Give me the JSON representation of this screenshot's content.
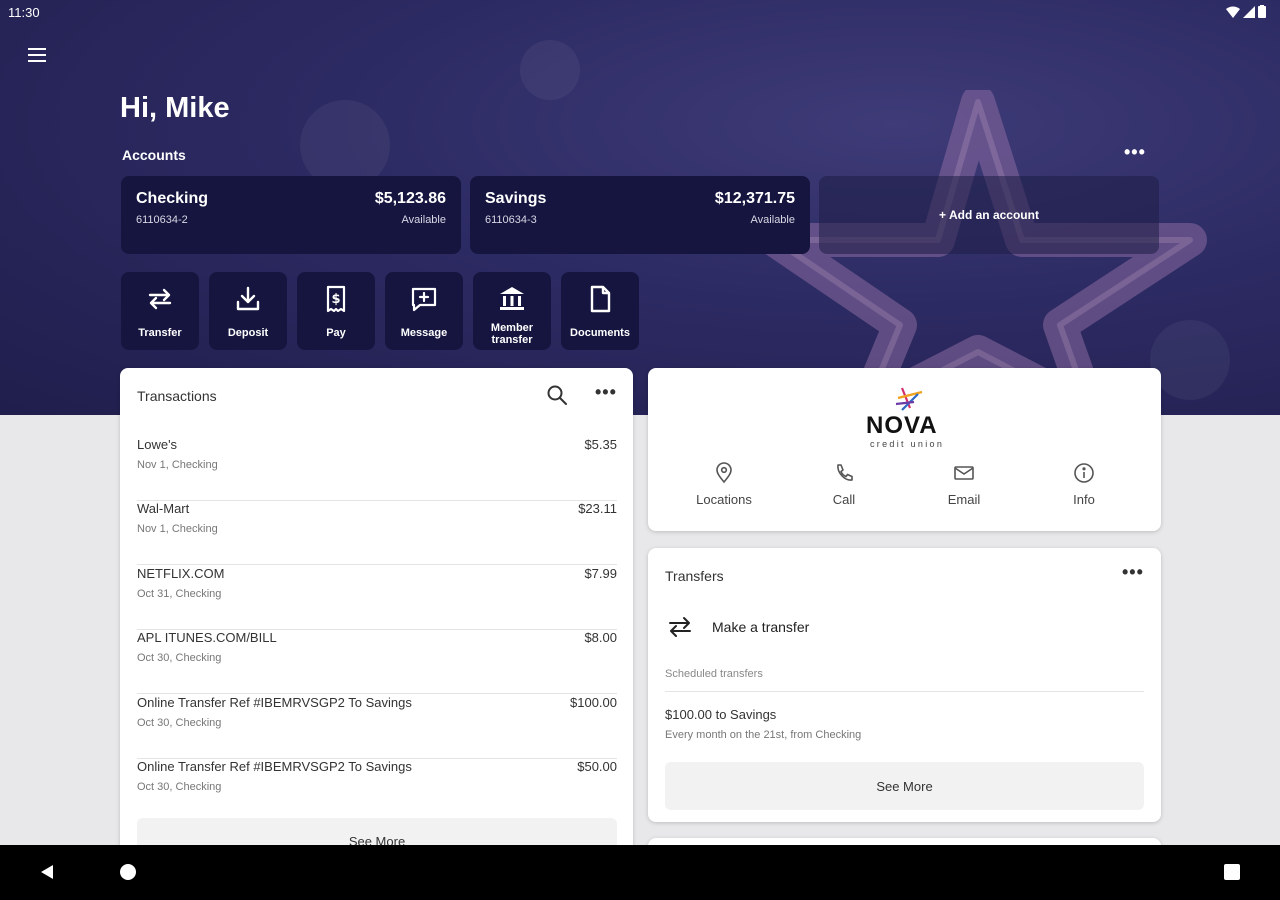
{
  "status": {
    "time": "11:30"
  },
  "header": {
    "greeting": "Hi, Mike",
    "accounts_label": "Accounts",
    "more": "•••"
  },
  "accounts": [
    {
      "name": "Checking",
      "number": "6110634-2",
      "balance": "$5,123.86",
      "available": "Available"
    },
    {
      "name": "Savings",
      "number": "6110634-3",
      "balance": "$12,371.75",
      "available": "Available"
    }
  ],
  "add_account": "+ Add an account",
  "actions": [
    {
      "label": "Transfer",
      "icon": "transfer-icon"
    },
    {
      "label": "Deposit",
      "icon": "deposit-icon"
    },
    {
      "label": "Pay",
      "icon": "pay-icon"
    },
    {
      "label": "Message",
      "icon": "message-icon"
    },
    {
      "label": "Member transfer",
      "icon": "bank-icon"
    },
    {
      "label": "Documents",
      "icon": "document-icon"
    }
  ],
  "transactions": {
    "title": "Transactions",
    "more": "•••",
    "rows": [
      {
        "merchant": "Lowe's",
        "detail": "Nov 1, Checking",
        "amount": "$5.35"
      },
      {
        "merchant": "Wal-Mart",
        "detail": "Nov 1, Checking",
        "amount": "$23.11"
      },
      {
        "merchant": "NETFLIX.COM",
        "detail": "Oct 31, Checking",
        "amount": "$7.99"
      },
      {
        "merchant": "APL ITUNES.COM/BILL",
        "detail": "Oct 30, Checking",
        "amount": "$8.00"
      },
      {
        "merchant": "Online Transfer Ref #IBEMRVSGP2 To Savings",
        "detail": "Oct 30, Checking",
        "amount": "$100.00"
      },
      {
        "merchant": "Online Transfer Ref #IBEMRVSGP2 To Savings",
        "detail": "Oct 30, Checking",
        "amount": "$50.00"
      }
    ],
    "see_more": "See More"
  },
  "nova": {
    "logo_word": "NOVA",
    "logo_sub": "credit union",
    "links": [
      {
        "label": "Locations",
        "icon": "location-pin-icon"
      },
      {
        "label": "Call",
        "icon": "phone-icon"
      },
      {
        "label": "Email",
        "icon": "email-icon"
      },
      {
        "label": "Info",
        "icon": "info-icon"
      }
    ]
  },
  "transfers": {
    "title": "Transfers",
    "more": "•••",
    "make_transfer": "Make a transfer",
    "scheduled_label": "Scheduled transfers",
    "item_title": "$100.00 to Savings",
    "item_subtitle": "Every month on the 21st, from Checking",
    "see_more": "See More"
  },
  "colors": {
    "hero": "#2c2a62",
    "tile": "#15153f",
    "page_bg": "#e8e8ea"
  }
}
